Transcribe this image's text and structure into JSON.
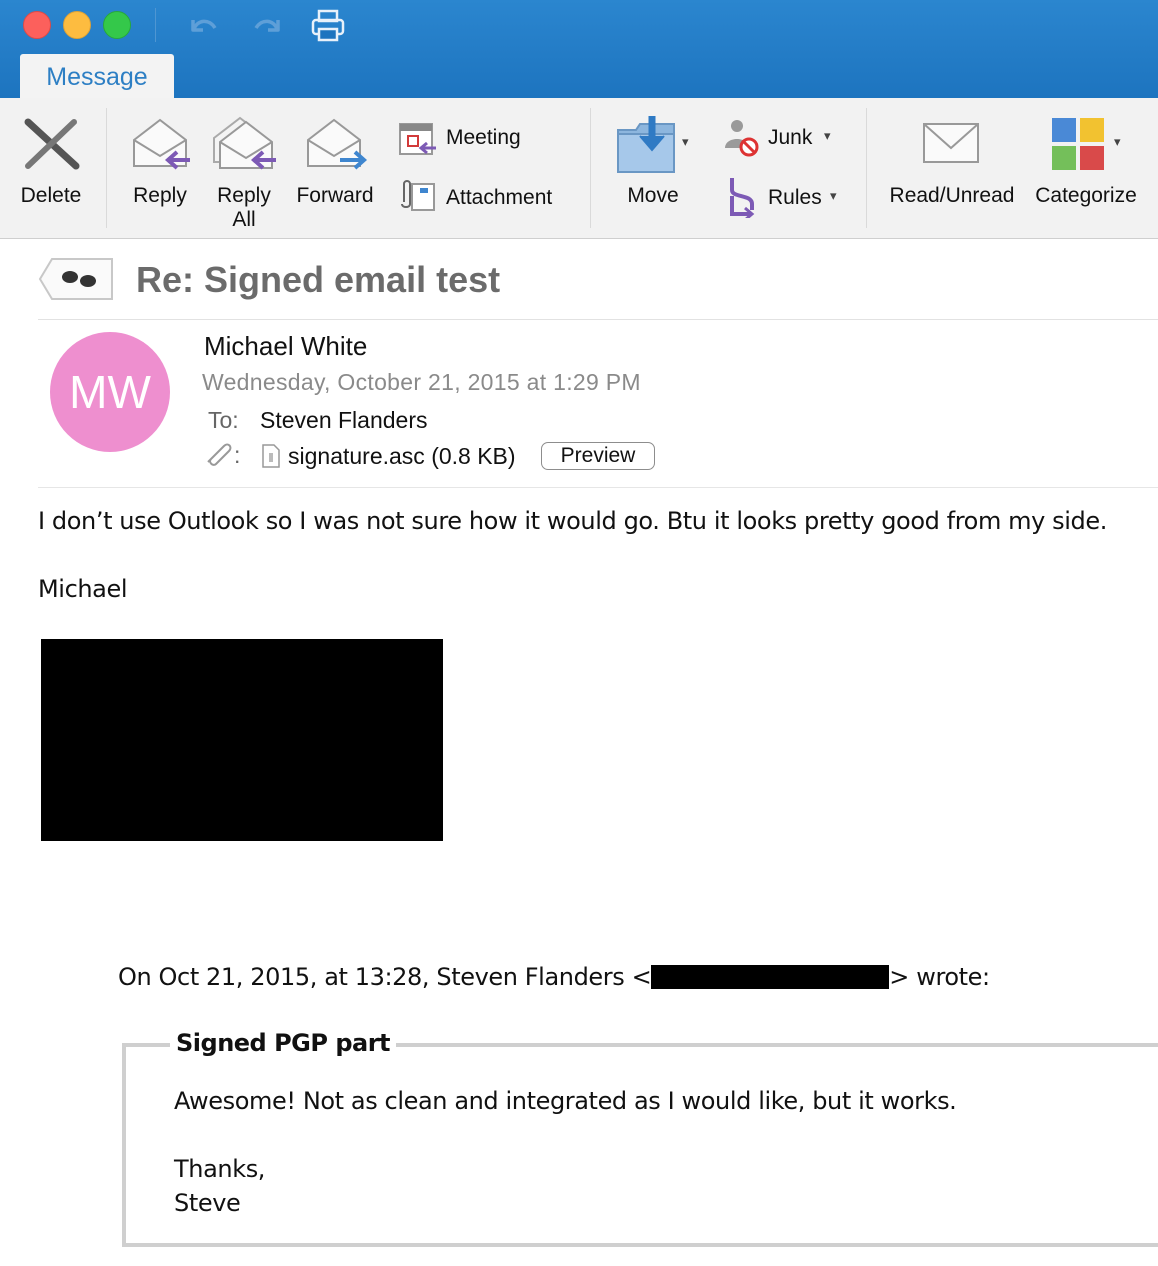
{
  "toolbar": {
    "tab_label": "Message",
    "delete_label": "Delete",
    "reply_label": "Reply",
    "reply_all_line1": "Reply",
    "reply_all_line2": "All",
    "forward_label": "Forward",
    "meeting_label": "Meeting",
    "attachment_label": "Attachment",
    "move_label": "Move",
    "junk_label": "Junk",
    "rules_label": "Rules",
    "read_unread_label": "Read/Unread",
    "categorize_label": "Categorize",
    "dropdown_glyph": "▾"
  },
  "message": {
    "subject": "Re: Signed email test",
    "avatar_initials": "MW",
    "avatar_color": "#ee8fcf",
    "sender": "Michael White",
    "date": "Wednesday, October 21, 2015 at 1:29 PM",
    "to_label": "To:",
    "to_name": "Steven Flanders",
    "attachment_colon": ":",
    "attachment_name": "signature.asc (0.8 KB)",
    "preview_label": "Preview"
  },
  "body": {
    "line1": "I don’t use Outlook so I was not sure how it would go.  Btu it looks pretty good from my side.",
    "signoff": "Michael",
    "quote_header_start": "On Oct 21, 2015, at 13:28, Steven Flanders <",
    "quote_header_end": "> wrote:",
    "pgp_title": "Signed PGP part",
    "pgp_line1": "Awesome! Not as clean and integrated as I would like, but it works.",
    "pgp_line2": "Thanks,",
    "pgp_line3": "Steve"
  },
  "colors": {
    "titlebar": "#1d74bf",
    "accent": "#2d7fc4",
    "ribbon": "#f2f2f2"
  }
}
